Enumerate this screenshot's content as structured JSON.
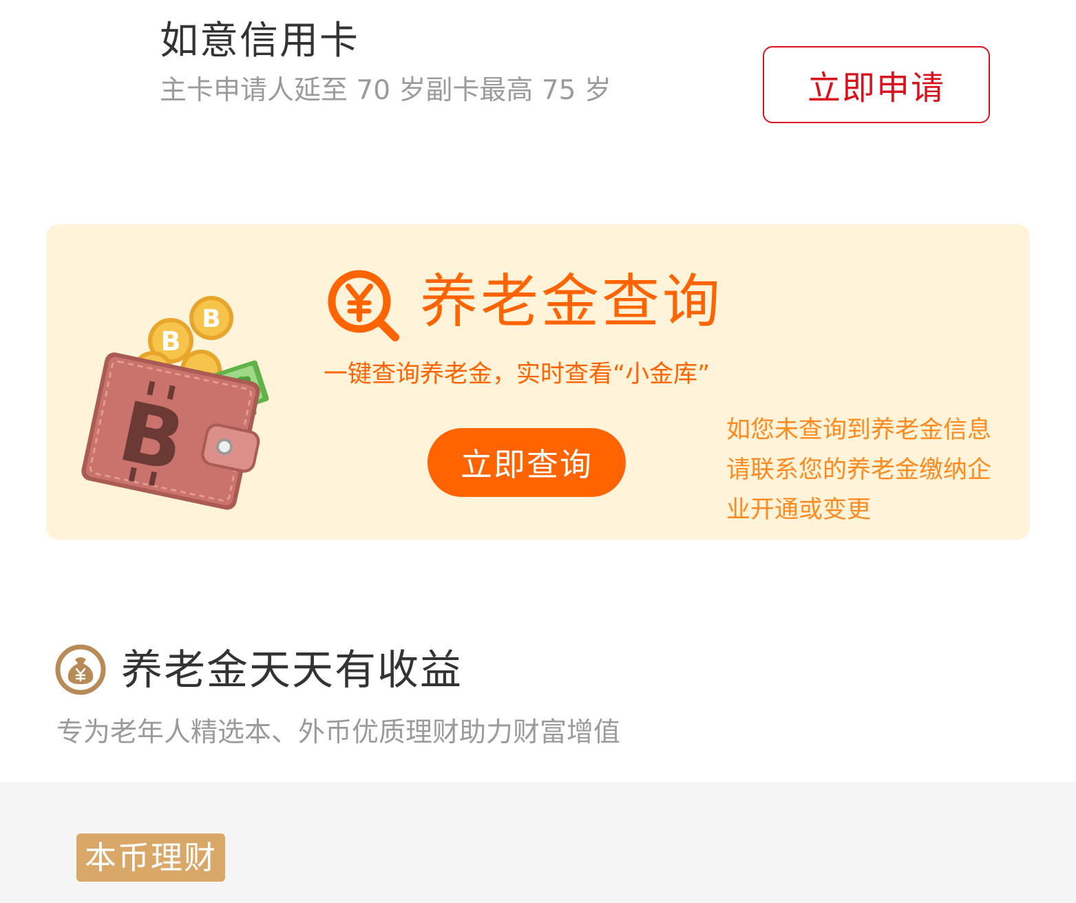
{
  "credit_card": {
    "title": "如意信用卡",
    "subtitle": "主卡申请人延至 70 岁副卡最高 75 岁",
    "apply_label": "立即申请"
  },
  "pension_banner": {
    "title": "养老金查询",
    "subtitle": "一键查询养老金，实时查看“小金库”",
    "query_label": "立即查询",
    "note_lines": [
      "如您未查询到养老金信息",
      "请联系您的养老金缴纳企",
      "业开通或变更"
    ],
    "illustration_icon": "wallet-bitcoin-icon",
    "search_icon": "yuan-search-icon",
    "accent_color": "#ff6400",
    "background_color": "#fff3d9"
  },
  "earnings_section": {
    "title": "养老金天天有收益",
    "subtitle": "专为老年人精选本、外币优质理财助力财富增值",
    "icon": "moneybag-icon"
  },
  "tag": {
    "label": "本币理财"
  }
}
